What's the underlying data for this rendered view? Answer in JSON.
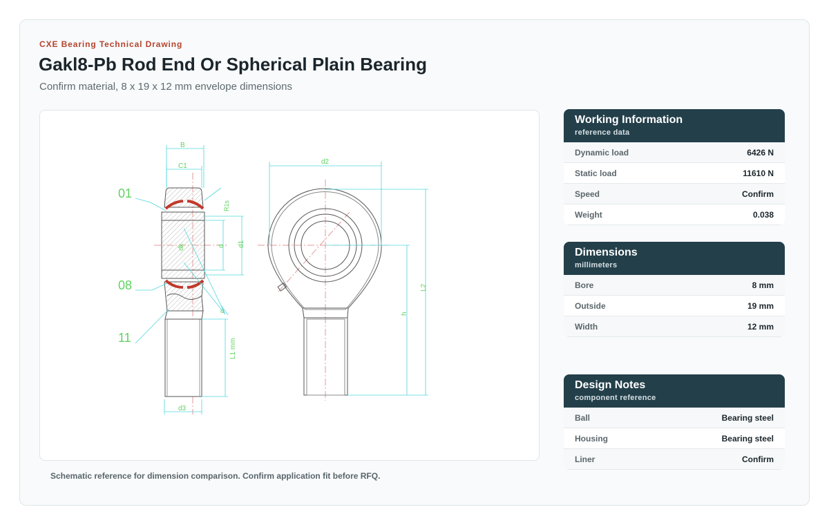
{
  "header": {
    "eyebrow": "CXE Bearing Technical Drawing",
    "title": "Gakl8-Pb Rod End Or Spherical Plain Bearing",
    "subtitle": "Confirm material, 8 x 19 x 12 mm envelope dimensions"
  },
  "drawing": {
    "part_labels": [
      "01",
      "08",
      "11"
    ],
    "dimension_labels": {
      "b": "B",
      "c1": "C1",
      "r1s": "R1s",
      "dk": "dk",
      "d": "d",
      "d1": "d1",
      "alpha": "α",
      "l1": "L1 mm",
      "d3": "d3",
      "d2": "d2",
      "h": "h",
      "l2": "L2"
    },
    "caption": "Schematic reference for dimension comparison. Confirm application fit before RFQ."
  },
  "panels": [
    {
      "title": "Working Information",
      "subtitle": "reference data",
      "rows": [
        {
          "label": "Dynamic load",
          "value": "6426 N"
        },
        {
          "label": "Static load",
          "value": "11610 N"
        },
        {
          "label": "Speed",
          "value": "Confirm"
        },
        {
          "label": "Weight",
          "value": "0.038"
        }
      ]
    },
    {
      "title": "Dimensions",
      "subtitle": "millimeters",
      "rows": [
        {
          "label": "Bore",
          "value": "8 mm"
        },
        {
          "label": "Outside",
          "value": "19 mm"
        },
        {
          "label": "Width",
          "value": "12 mm"
        }
      ]
    },
    {
      "title": "Design Notes",
      "subtitle": "component reference",
      "rows": [
        {
          "label": "Ball",
          "value": "Bearing steel"
        },
        {
          "label": "Housing",
          "value": "Bearing steel"
        },
        {
          "label": "Liner",
          "value": "Confirm"
        }
      ]
    }
  ],
  "colors": {
    "accent": "#b4432d",
    "panel_header": "#233f4a",
    "dimension_line": "#4fd6dc",
    "label_green": "#5fd35f",
    "liner_red": "#c0392b"
  }
}
